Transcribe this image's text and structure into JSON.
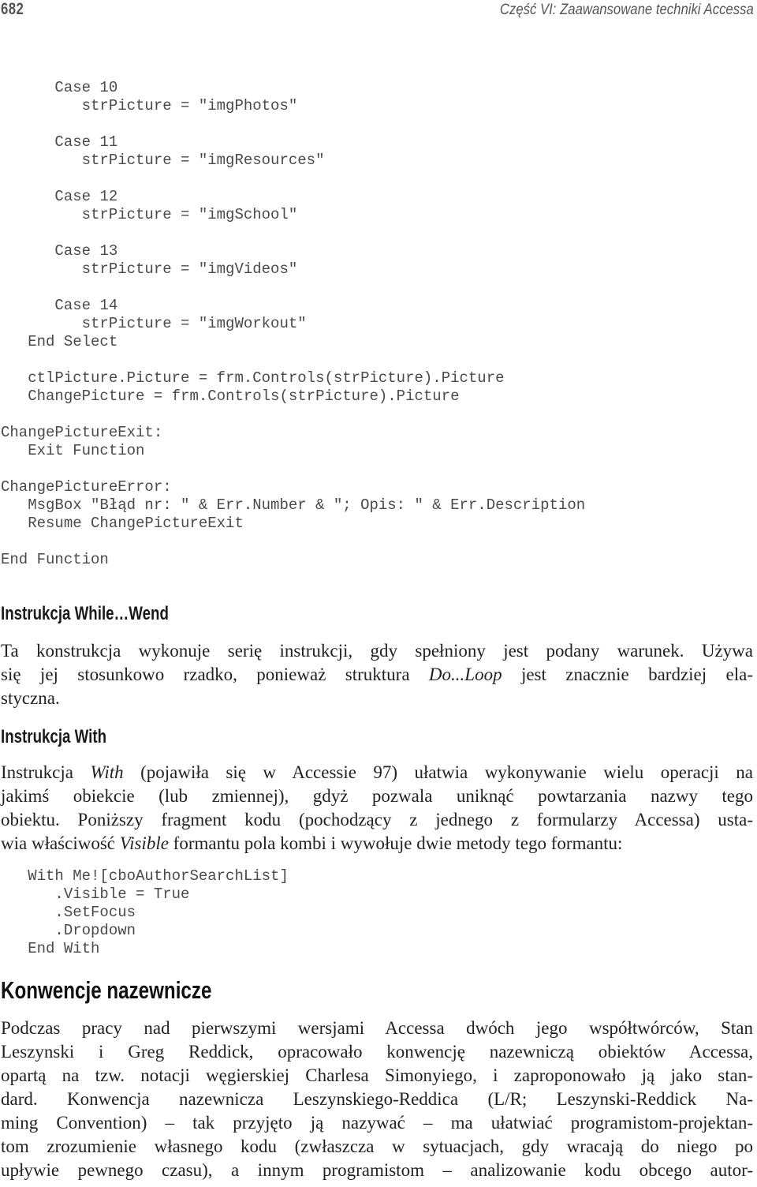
{
  "header": {
    "page_number": "682",
    "running_title": "Część VI: Zaawansowane techniki Accessa"
  },
  "code_block_1": {
    "lines": [
      "      Case 10",
      "         strPicture = \"imgPhotos\"",
      "",
      "      Case 11",
      "         strPicture = \"imgResources\"",
      "",
      "      Case 12",
      "         strPicture = \"imgSchool\"",
      "",
      "      Case 13",
      "         strPicture = \"imgVideos\"",
      "",
      "      Case 14",
      "         strPicture = \"imgWorkout\"",
      "   End Select",
      "",
      "   ctlPicture.Picture = frm.Controls(strPicture).Picture",
      "   ChangePicture = frm.Controls(strPicture).Picture",
      "",
      "ChangePictureExit:",
      "   Exit Function",
      "",
      "ChangePictureError:",
      "   MsgBox \"Błąd nr: \" & Err.Number & \"; Opis: \" & Err.Description",
      "   Resume ChangePictureExit",
      "",
      "End Function"
    ]
  },
  "section_while": {
    "heading": "Instrukcja While…Wend",
    "paragraph": {
      "l1": "Ta konstrukcja wykonuje serię instrukcji, gdy spełniony jest podany warunek. Używa",
      "l2a": "się jej stosunkowo rzadko, ponieważ struktura ",
      "l2b": "Do...Loop",
      "l2c": " jest znacznie bardziej ela-",
      "l3": "styczna."
    }
  },
  "section_with": {
    "heading": "Instrukcja With",
    "paragraph": {
      "l1a": "Instrukcja ",
      "l1b": "With",
      "l1c": " (pojawiła się w Accessie 97) ułatwia wykonywanie wielu operacji na",
      "l2": "jakimś obiekcie (lub zmiennej), gdyż pozwala uniknąć powtarzania nazwy tego",
      "l3": "obiektu. Poniższy fragment kodu (pochodzący z jednego z formularzy Accessa) usta-",
      "l4a": "wia właściwość ",
      "l4b": "Visible",
      "l4c": " formantu pola kombi i wywołuje dwie metody tego formantu:"
    },
    "code": {
      "lines": [
        "   With Me![cboAuthorSearchList]",
        "      .Visible = True",
        "      .SetFocus",
        "      .Dropdown",
        "   End With"
      ]
    }
  },
  "section_naming": {
    "heading": "Konwencje nazewnicze",
    "paragraph_lines": [
      "Podczas pracy nad pierwszymi wersjami Accessa dwóch jego współtwórców, Stan",
      "Leszynski i Greg Reddick, opracowało konwencję nazewniczą obiektów Accessa,",
      "opartą na tzw. notacji węgierskiej Charlesa Simonyiego, i zaproponowało ją jako stan-",
      "dard. Konwencja nazewnicza Leszynskiego-Reddica (L/R; Leszynski-Reddick Na-",
      "ming Convention) – tak przyjęto ją nazywać – ma ułatwiać programistom-projektan-",
      "tom zrozumienie własnego kodu (zwłaszcza w sytuacjach, gdy wracają do niego po",
      "upływie pewnego czasu), a innym programistom – analizowanie kodu obcego autor-"
    ]
  }
}
